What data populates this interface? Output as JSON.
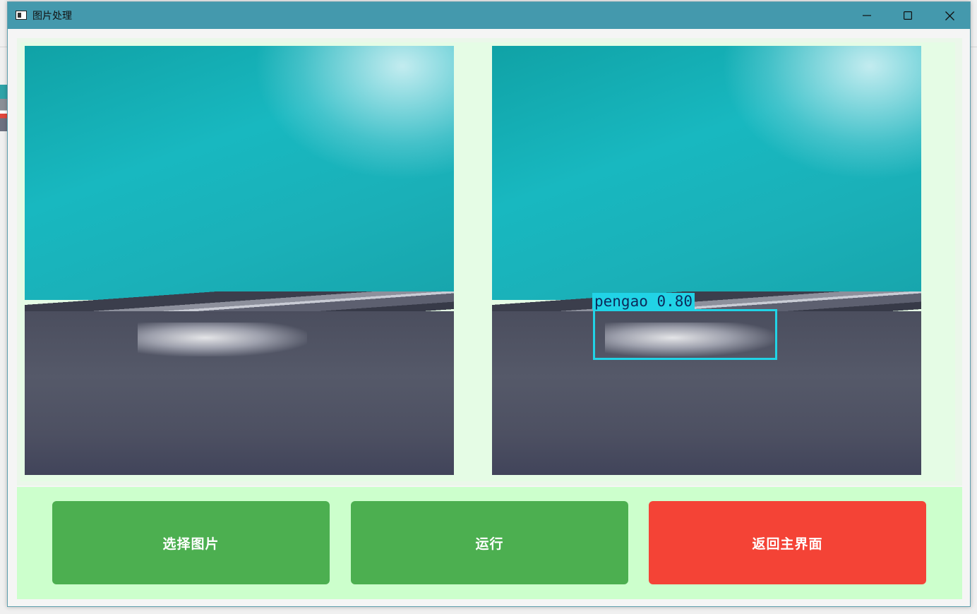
{
  "window": {
    "title": "图片处理",
    "title_bar_color": "#4499ad"
  },
  "controls": {
    "minimize_icon": "minimize-icon",
    "maximize_icon": "maximize-icon",
    "close_icon": "close-icon"
  },
  "images": {
    "original": {
      "icon": "defect-photo"
    },
    "result": {
      "icon": "defect-photo-annotated",
      "detection": {
        "label": "pengao 0.80",
        "box_color": "#21d3e6"
      }
    }
  },
  "buttons": {
    "select_image": {
      "label": "选择图片",
      "color": "#4caf50"
    },
    "run": {
      "label": "运行",
      "color": "#4caf50"
    },
    "back_home": {
      "label": "返回主界面",
      "color": "#f44336"
    }
  }
}
